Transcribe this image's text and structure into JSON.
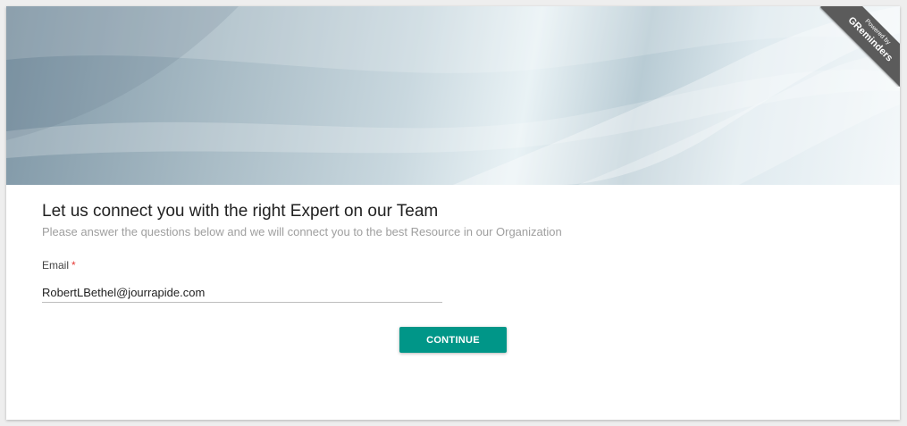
{
  "banner": {
    "powered_by": "Powered by",
    "brand": "GReminders"
  },
  "form": {
    "title": "Let us connect you with the right Expert on our Team",
    "subtitle": "Please answer the questions below and we will connect you to the best Resource in our Organization",
    "email_label": "Email",
    "required_marker": "*",
    "email_value": "RobertLBethel@jourrapide.com",
    "continue_label": "CONTINUE"
  },
  "colors": {
    "accent": "#009688",
    "required": "#e53935"
  }
}
